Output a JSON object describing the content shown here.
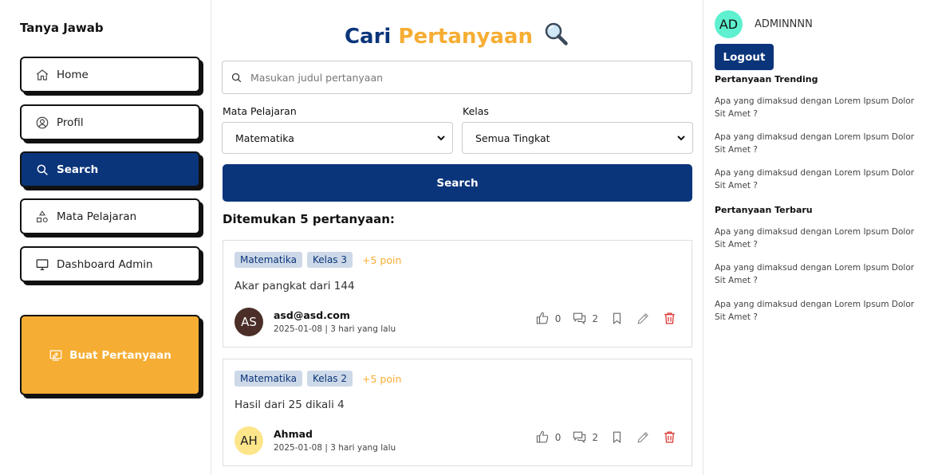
{
  "sidebar": {
    "brand": "Tanya Jawab",
    "items": [
      {
        "label": "Home",
        "icon": "home-icon"
      },
      {
        "label": "Profil",
        "icon": "user-icon"
      },
      {
        "label": "Search",
        "icon": "search-icon",
        "active": true
      },
      {
        "label": "Mata Pelajaran",
        "icon": "shapes-icon"
      },
      {
        "label": "Dashboard Admin",
        "icon": "monitor-icon"
      }
    ],
    "ask_button": "Buat Pertanyaan"
  },
  "main": {
    "title_part1": "Cari",
    "title_part2": "Pertanyaan",
    "search_placeholder": "Masukan judul pertanyaan",
    "subject_label": "Mata Pelajaran",
    "subject_value": "Matematika",
    "class_label": "Kelas",
    "class_value": "Semua Tingkat",
    "search_button": "Search",
    "result_count": "Ditemukan 5 pertanyaan:",
    "questions": [
      {
        "subject": "Matematika",
        "kelas": "Kelas 3",
        "poin": "+5 poin",
        "text": "Akar pangkat dari 144",
        "avatar_initials": "AS",
        "username": "asd@asd.com",
        "meta": "2025-01-08 | 3 hari yang lalu",
        "likes": "0",
        "comments": "2"
      },
      {
        "subject": "Matematika",
        "kelas": "Kelas 2",
        "poin": "+5 poin",
        "text": "Hasil dari 25 dikali 4",
        "avatar_initials": "AH",
        "username": "Ahmad",
        "meta": "2025-01-08 | 3 hari yang lalu",
        "likes": "0",
        "comments": "2"
      }
    ]
  },
  "right": {
    "avatar_initials": "AD",
    "admin_name": "ADMINNNN",
    "logout": "Logout",
    "trending_title": "Pertanyaan Trending",
    "trending": [
      "Apa yang dimaksud dengan Lorem Ipsum Dolor Sit Amet ?",
      "Apa yang dimaksud dengan Lorem Ipsum Dolor Sit Amet ?",
      "Apa yang dimaksud dengan Lorem Ipsum Dolor Sit Amet ?"
    ],
    "latest_title": "Pertanyaan Terbaru",
    "latest": [
      "Apa yang dimaksud dengan Lorem Ipsum Dolor Sit Amet ?",
      "Apa yang dimaksud dengan Lorem Ipsum Dolor Sit Amet ?",
      "Apa yang dimaksud dengan Lorem Ipsum Dolor Sit Amet ?"
    ]
  },
  "colors": {
    "primary": "#0b357a",
    "accent": "#f6ad33",
    "tag_bg": "#cdd9e8",
    "admin_avatar": "#5ef0cf",
    "avatar_as": "#4a2e27",
    "avatar_ah": "#fde58a",
    "delete": "#d9312e"
  }
}
